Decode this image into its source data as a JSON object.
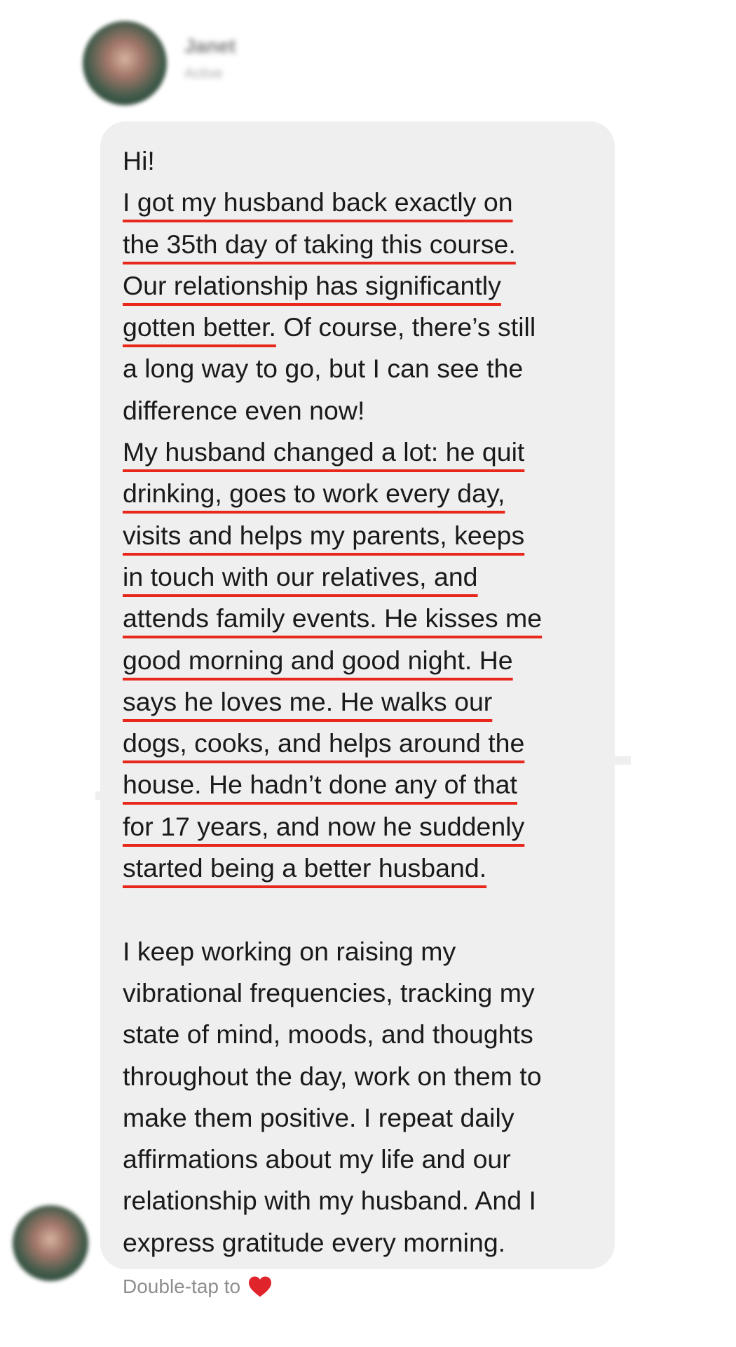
{
  "header": {
    "name": "Janet",
    "subtitle": "Active"
  },
  "message": {
    "lines": [
      "Hi!",
      "I got my husband back exactly on",
      "the 35th day of taking this course.",
      "Our relationship has significantly",
      "gotten better.",
      " Of course, there’s still",
      "a long way to go, but I can see the",
      "difference even now!",
      "My husband changed a lot: he quit",
      "drinking, goes to work every day,",
      "visits and helps my parents, keeps",
      "in touch with our relatives, and",
      "attends family events. He kisses me",
      "good morning and good night.  He",
      "says he loves me. He walks our",
      "dogs, cooks, and helps around the",
      "house. He hadn’t done any of that",
      "for 17 years, and now he suddenly",
      "started being a better husband.",
      "I keep working on raising my",
      "vibrational frequencies, tracking my",
      "state of mind, moods, and thoughts",
      "throughout the day, work on them to",
      "make them positive. I repeat daily",
      "affirmations about my life and our",
      "relationship with my husband. And I",
      "express gratitude every morning."
    ]
  },
  "footer": {
    "label": "Double-tap to",
    "icon": "heart-icon",
    "icon_color": "#e0242b"
  },
  "colors": {
    "bubble": "#efefef",
    "underline": "#e8281c",
    "text": "#1a1a1a",
    "muted": "#8e8e8e"
  }
}
